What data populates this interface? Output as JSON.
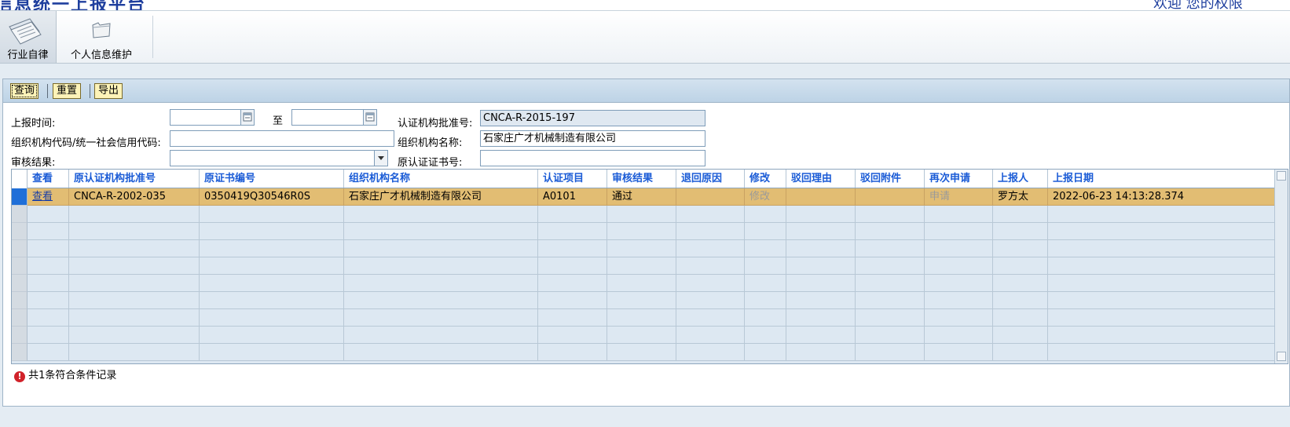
{
  "banner": {
    "title": "信息统一上报平台",
    "right_text": "欢迎 您的权限"
  },
  "toolbar": {
    "items": [
      {
        "label": "行业自律",
        "icon": "documents-icon"
      },
      {
        "label": "个人信息维护",
        "icon": "folder-icon"
      }
    ]
  },
  "actions": {
    "query": "查询",
    "reset": "重置",
    "export": "导出"
  },
  "form": {
    "report_time_label": "上报时间:",
    "to_label": "至",
    "date_from": "",
    "date_to": "",
    "cert_body_label": "认证机构批准号:",
    "cert_body_value": "CNCA-R-2015-197",
    "org_code_label": "组织机构代码/统一社会信用代码:",
    "org_code_value": "",
    "org_name_label": "组织机构名称:",
    "org_name_value": "石家庄广才机械制造有限公司",
    "review_label": "审核结果:",
    "review_value": "",
    "orig_cert_label": "原认证证书号:",
    "orig_cert_value": ""
  },
  "table": {
    "headers": [
      "查看",
      "原认证机构批准号",
      "原证书编号",
      "组织机构名称",
      "认证项目",
      "审核结果",
      "退回原因",
      "修改",
      "驳回理由",
      "驳回附件",
      "再次申请",
      "上报人",
      "上报日期"
    ],
    "rows": [
      [
        "查看",
        "CNCA-R-2002-035",
        "0350419Q30546R0S",
        "石家庄广才机械制造有限公司",
        "A0101",
        "通过",
        "",
        "修改",
        "",
        "",
        "申请",
        "罗方太",
        "2022-06-23 14:13:28.374"
      ]
    ]
  },
  "status": {
    "icon": "warning-icon",
    "text": "共1条符合条件记录"
  }
}
